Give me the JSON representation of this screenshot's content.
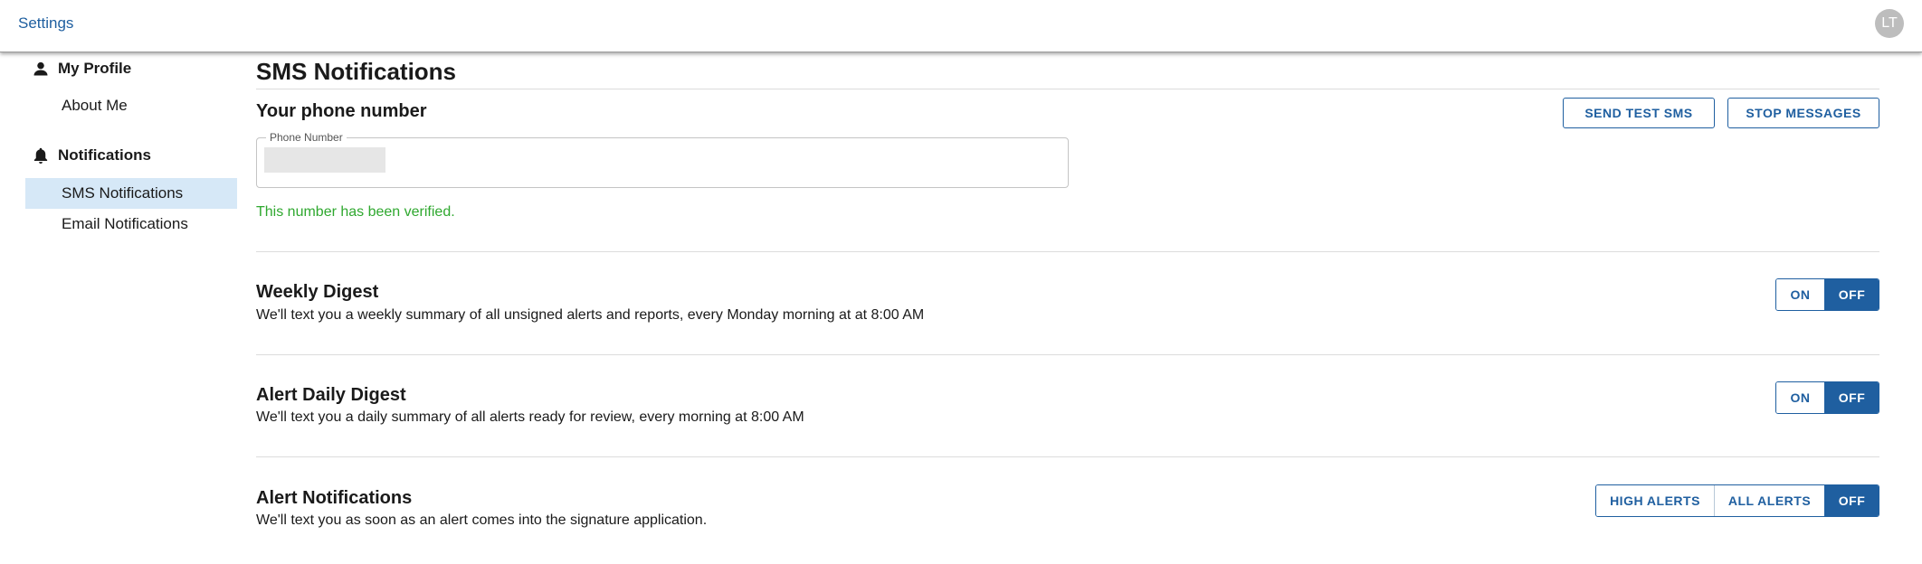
{
  "app": {
    "title": "Settings",
    "user_initials": "LT"
  },
  "sidebar": {
    "groups": [
      {
        "label": "My Profile",
        "icon": "person-icon",
        "items": [
          {
            "label": "About Me"
          }
        ]
      },
      {
        "label": "Notifications",
        "icon": "bell-icon",
        "items": [
          {
            "label": "SMS Notifications",
            "active": true
          },
          {
            "label": "Email Notifications"
          }
        ]
      }
    ]
  },
  "main": {
    "title": "SMS Notifications",
    "phone": {
      "heading": "Your phone number",
      "field_label": "Phone Number",
      "value_masked": true,
      "verified_text": "This number has been verified.",
      "send_test_label": "SEND TEST SMS",
      "stop_label": "STOP MESSAGES"
    },
    "settings": [
      {
        "title": "Weekly Digest",
        "description": "We'll text you a weekly summary of all unsigned alerts and reports, every Monday morning at at 8:00 AM",
        "options": [
          "ON",
          "OFF"
        ],
        "selected": "OFF"
      },
      {
        "title": "Alert Daily Digest",
        "description": "We'll text you a daily summary of all alerts ready for review, every morning at 8:00 AM",
        "options": [
          "ON",
          "OFF"
        ],
        "selected": "OFF"
      },
      {
        "title": "Alert Notifications",
        "description": "We'll text you as soon as an alert comes into the signature application.",
        "options": [
          "HIGH ALERTS",
          "ALL ALERTS",
          "OFF"
        ],
        "selected": "OFF"
      }
    ]
  },
  "colors": {
    "accent": "#1f5fa0",
    "verified": "#2fa82f",
    "active_bg": "#d6e8f7"
  }
}
